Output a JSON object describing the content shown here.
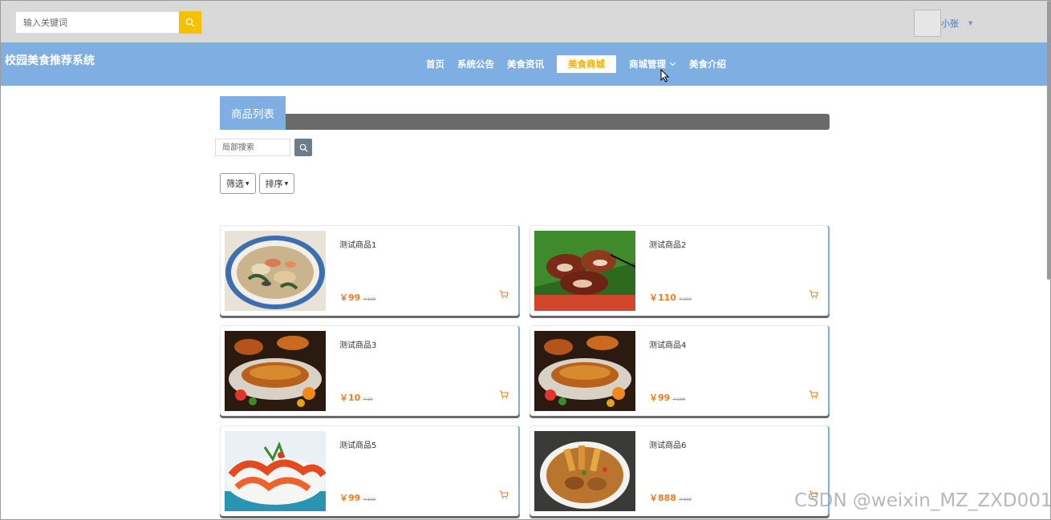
{
  "header": {
    "search": {
      "placeholder": "输入关键词",
      "value": ""
    },
    "user": {
      "name": "小张"
    }
  },
  "nav": {
    "brand": "校园美食推荐系统",
    "items": [
      {
        "label": "首页",
        "active": false
      },
      {
        "label": "系统公告",
        "active": false
      },
      {
        "label": "美食资讯",
        "active": false
      },
      {
        "label": "美食商城",
        "active": true
      },
      {
        "label": "商城管理",
        "active": false,
        "dropdown": true
      },
      {
        "label": "美食介绍",
        "active": false
      }
    ]
  },
  "section": {
    "title": "商品列表",
    "local_search": {
      "placeholder": "局部搜索",
      "value": ""
    },
    "filter_label": "筛选",
    "sort_label": "排序"
  },
  "products": [
    {
      "name": "测试商品1",
      "price": "￥99",
      "old_price": "￥119",
      "image": "noodle-soup"
    },
    {
      "name": "测试商品2",
      "price": "￥110",
      "old_price": "￥200",
      "image": "grilled-pork"
    },
    {
      "name": "测试商品3",
      "price": "￥10",
      "old_price": "￥20",
      "image": "roast-fish"
    },
    {
      "name": "测试商品4",
      "price": "￥99",
      "old_price": "￥100",
      "image": "roast-fish"
    },
    {
      "name": "测试商品5",
      "price": "￥99",
      "old_price": "￥119",
      "image": "shrimp"
    },
    {
      "name": "测试商品6",
      "price": "￥888",
      "old_price": "￥999",
      "image": "stew-bowl"
    }
  ],
  "watermark": "CSDN @weixin_MZ_ZXD001",
  "colors": {
    "nav_bg": "#7eaee2",
    "accent_yellow": "#f6c200",
    "price": "#f07c21",
    "topbar_bg": "#d9d9d9"
  }
}
